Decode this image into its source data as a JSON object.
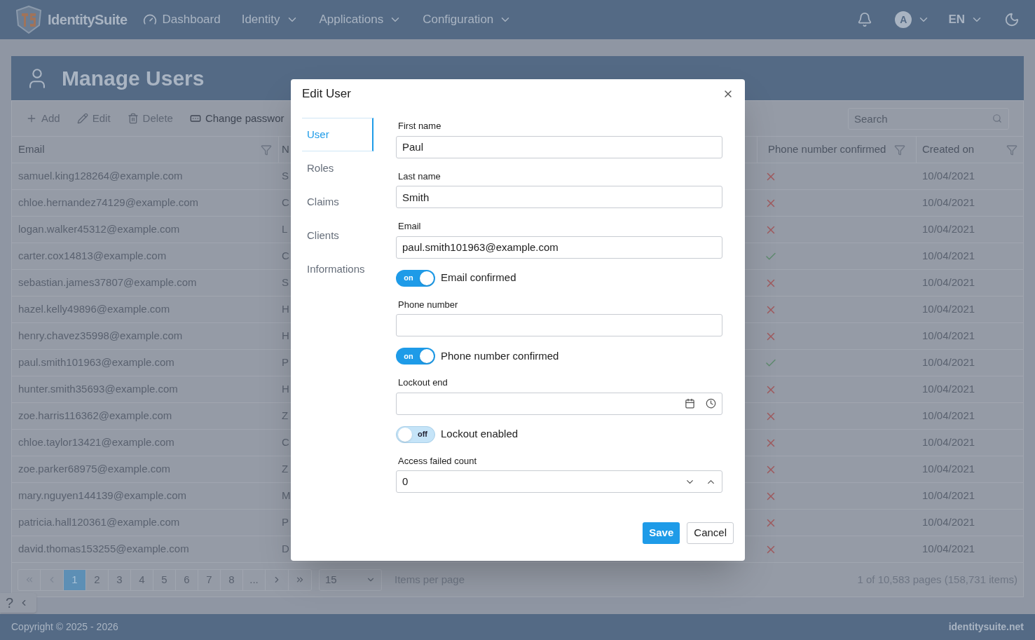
{
  "navbar": {
    "brand": "IdentitySuite",
    "items": [
      {
        "label": "Dashboard",
        "kind": "link"
      },
      {
        "label": "Identity",
        "kind": "menu"
      },
      {
        "label": "Applications",
        "kind": "menu"
      },
      {
        "label": "Configuration",
        "kind": "menu"
      }
    ],
    "avatar": "A",
    "language": "EN"
  },
  "page": {
    "title": "Manage Users",
    "toolbar": [
      {
        "label": "Add",
        "disabled": true
      },
      {
        "label": "Edit",
        "disabled": true
      },
      {
        "label": "Delete",
        "disabled": true
      },
      {
        "label": "Change passwor",
        "disabled": false
      }
    ],
    "search": {
      "placeholder": "Search"
    },
    "table": {
      "columns": [
        "Email",
        "N",
        "Phone number confirmed",
        "Created on"
      ],
      "rows": [
        {
          "email": "samuel.king128264@example.com",
          "name": "S",
          "phone_confirmed": false,
          "created": "10/04/2021"
        },
        {
          "email": "chloe.hernandez74129@example.com",
          "name": "C",
          "phone_confirmed": false,
          "created": "10/04/2021"
        },
        {
          "email": "logan.walker45312@example.com",
          "name": "L",
          "phone_confirmed": false,
          "created": "10/04/2021"
        },
        {
          "email": "carter.cox14813@example.com",
          "name": "C",
          "phone_confirmed": true,
          "created": "10/04/2021"
        },
        {
          "email": "sebastian.james37807@example.com",
          "name": "S",
          "phone_confirmed": false,
          "created": "10/04/2021"
        },
        {
          "email": "hazel.kelly49896@example.com",
          "name": "H",
          "phone_confirmed": false,
          "created": "10/04/2021"
        },
        {
          "email": "henry.chavez35998@example.com",
          "name": "H",
          "phone_confirmed": false,
          "created": "10/04/2021"
        },
        {
          "email": "paul.smith101963@example.com",
          "name": "P",
          "phone_confirmed": true,
          "created": "10/04/2021"
        },
        {
          "email": "hunter.smith35693@example.com",
          "name": "H",
          "phone_confirmed": false,
          "created": "10/04/2021"
        },
        {
          "email": "zoe.harris116362@example.com",
          "name": "Z",
          "phone_confirmed": false,
          "created": "10/04/2021"
        },
        {
          "email": "chloe.taylor13421@example.com",
          "name": "C",
          "phone_confirmed": false,
          "created": "10/04/2021"
        },
        {
          "email": "zoe.parker68975@example.com",
          "name": "Z",
          "phone_confirmed": false,
          "created": "10/04/2021"
        },
        {
          "email": "mary.nguyen144139@example.com",
          "name": "M",
          "phone_confirmed": false,
          "created": "10/04/2021"
        },
        {
          "email": "patricia.hall120361@example.com",
          "name": "P",
          "phone_confirmed": false,
          "created": "10/04/2021"
        },
        {
          "email": "david.thomas153255@example.com",
          "name": "D",
          "phone_confirmed": false,
          "created": "10/04/2021"
        }
      ]
    },
    "pager": {
      "pages": [
        {
          "label": "1",
          "selected": true
        },
        {
          "label": "2",
          "selected": false
        },
        {
          "label": "3",
          "selected": false
        },
        {
          "label": "4",
          "selected": false
        },
        {
          "label": "5",
          "selected": false
        },
        {
          "label": "6",
          "selected": false
        },
        {
          "label": "7",
          "selected": false
        },
        {
          "label": "8",
          "selected": false
        },
        {
          "label": "...",
          "selected": false
        }
      ],
      "page_size": "15",
      "page_size_label": "Items per page",
      "summary": "1 of 10,583 pages (158,731 items)"
    },
    "help": "?"
  },
  "footer": {
    "copyright": "Copyright © 2025 - 2026",
    "site": "identitysuite.net"
  },
  "dialog": {
    "title": "Edit User",
    "tabs": [
      {
        "label": "User",
        "selected": true
      },
      {
        "label": "Roles",
        "selected": false
      },
      {
        "label": "Claims",
        "selected": false
      },
      {
        "label": "Clients",
        "selected": false
      },
      {
        "label": "Informations",
        "selected": false
      }
    ],
    "fields": [
      {
        "kind": "text",
        "label": "First name",
        "value": "Paul"
      },
      {
        "kind": "text",
        "label": "Last name",
        "value": "Smith"
      },
      {
        "kind": "text",
        "label": "Email",
        "value": "paul.smith101963@example.com"
      },
      {
        "kind": "toggle",
        "label": "Email confirmed",
        "on": true,
        "state_text": "on"
      },
      {
        "kind": "text",
        "label": "Phone number"
      },
      {
        "kind": "toggle",
        "label": "Phone number confirmed",
        "on": true,
        "state_text": "on"
      },
      {
        "kind": "datetime",
        "label": "Lockout end"
      },
      {
        "kind": "toggle",
        "label": "Lockout enabled",
        "on": false,
        "state_text": "off"
      },
      {
        "kind": "number",
        "label": "Access failed count",
        "value": "0"
      }
    ],
    "buttons": [
      {
        "label": "Save",
        "primary": true
      },
      {
        "label": "Cancel",
        "primary": false
      }
    ]
  }
}
